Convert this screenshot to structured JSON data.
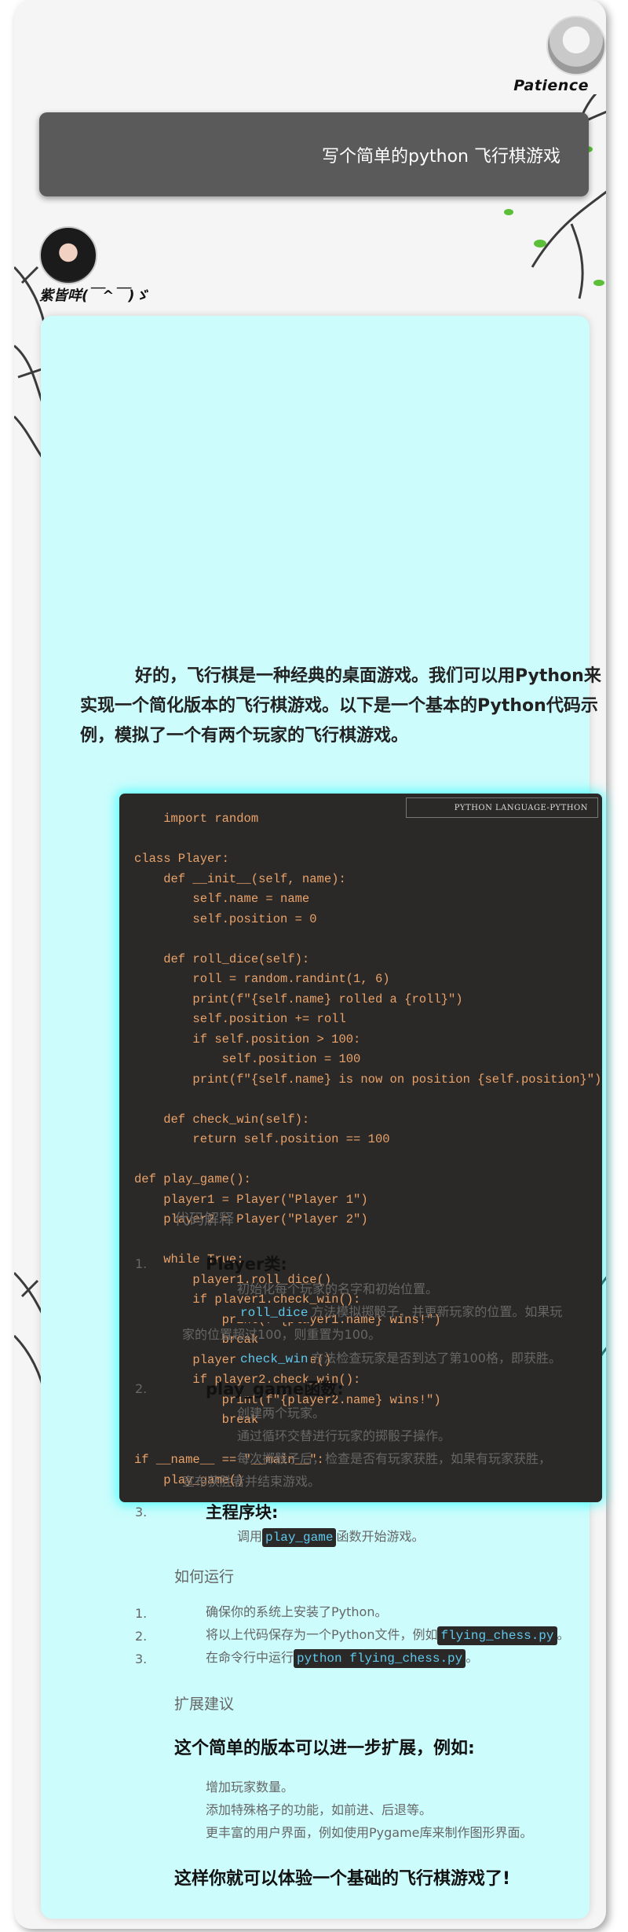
{
  "user": {
    "name": "Patience",
    "message": "写个简单的python 飞行棋游戏"
  },
  "bot": {
    "name": "紫皆咩(￣^￣)ゞ"
  },
  "answer": {
    "intro": "好的，飞行棋是一种经典的桌面游戏。我们可以用Python来实现一个简化版本的飞行棋游戏。以下是一个基本的Python代码示例，模拟了一个有两个玩家的飞行棋游戏。",
    "code_language_label": "PYTHON LANGUAGE-PYTHON",
    "code": "    import random\n\nclass Player:\n    def __init__(self, name):\n        self.name = name\n        self.position = 0\n\n    def roll_dice(self):\n        roll = random.randint(1, 6)\n        print(f\"{self.name} rolled a {roll}\")\n        self.position += roll\n        if self.position > 100:\n            self.position = 100\n        print(f\"{self.name} is now on position {self.position}\")\n\n    def check_win(self):\n        return self.position == 100\n\ndef play_game():\n    player1 = Player(\"Player 1\")\n    player2 = Player(\"Player 2\")\n\n    while True:\n        player1.roll_dice()\n        if player1.check_win():\n            print(f\"{player1.name} wins!\")\n            break\n        player2.roll_dice()\n        if player2.check_win():\n            print(f\"{player2.name} wins!\")\n            break\n\nif __name__ == \"__main__\":\n    play_game()",
    "explain_heading": "代码解释",
    "explain_items": [
      {
        "num": "1.",
        "title": "Player类:",
        "line1": "初始化每个玩家的名字和初始位置。",
        "line2_code": "roll_dice",
        "line2_text": "方法模拟掷骰子，并更新玩家的位置。如果玩",
        "line2_cont": "家的位置超过100，则重置为100。",
        "line3_code": "check_win",
        "line3_text": "方法检查玩家是否到达了第100格，即获胜。"
      },
      {
        "num": "2.",
        "title": "play_game函数:",
        "line1": "创建两个玩家。",
        "line2": "通过循环交替进行玩家的掷骰子操作。",
        "line3": "每次掷骰子后，检查是否有玩家获胜，如果有玩家获胜，",
        "line3_cont": "宣布获胜者并结束游戏。"
      },
      {
        "num": "3.",
        "title": "主程序块:",
        "line1_pre": "调用",
        "line1_code": "play_game",
        "line1_post": "函数开始游戏。"
      }
    ],
    "run_heading": "如何运行",
    "run_items": [
      {
        "num": "1.",
        "text": "确保你的系统上安装了Python。"
      },
      {
        "num": "2.",
        "text": "将以上代码保存为一个Python文件，例如",
        "code": "flying_chess.py",
        "post": "。"
      },
      {
        "num": "3.",
        "text": "在命令行中运行",
        "code": "python flying_chess.py",
        "post": "。"
      }
    ],
    "ext_heading": "扩展建议",
    "ext_lead": "这个简单的版本可以进一步扩展，例如:",
    "ext_items": [
      "增加玩家数量。",
      "添加特殊格子的功能，如前进、后退等。",
      "更丰富的用户界面，例如使用Pygame库来制作图形界面。"
    ],
    "closing": "这样你就可以体验一个基础的飞行棋游戏了!"
  }
}
